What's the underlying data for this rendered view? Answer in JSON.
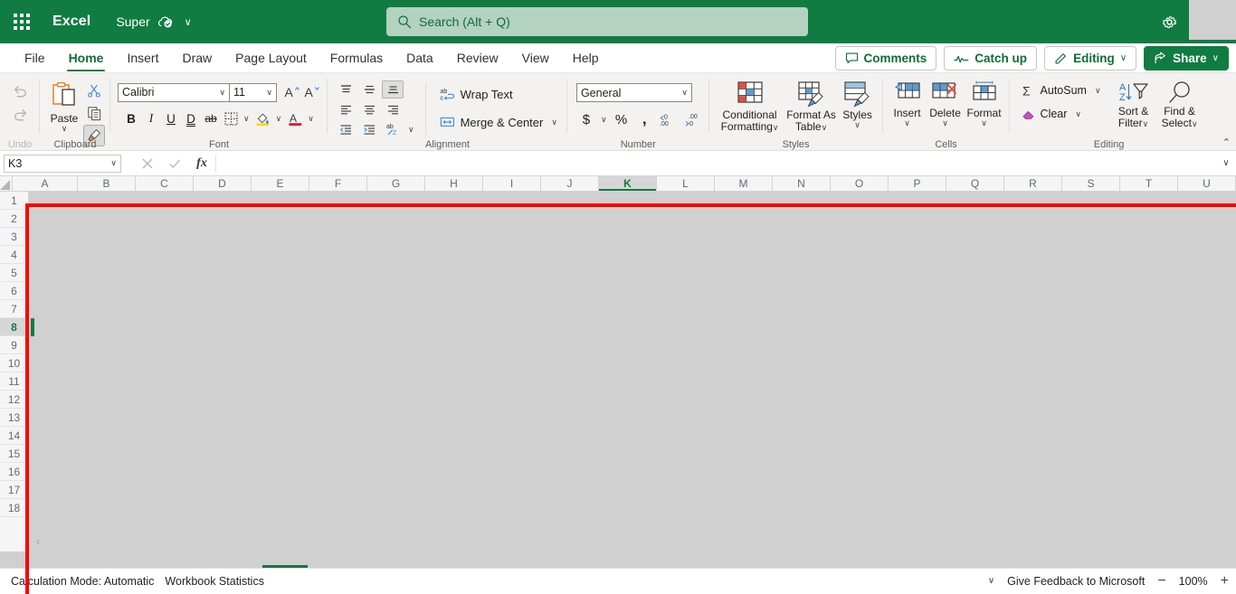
{
  "titlebar": {
    "waffle_label": "app-launcher",
    "app_name": "Excel",
    "document_name": "Super",
    "saved_icon": "cloud-saved-icon",
    "chevron": "∨",
    "settings_icon": "gear-icon"
  },
  "search": {
    "placeholder": "Search (Alt + Q)",
    "value": "",
    "icon": "search-icon"
  },
  "tabs": [
    {
      "label": "File",
      "active": false
    },
    {
      "label": "Home",
      "active": true
    },
    {
      "label": "Insert",
      "active": false
    },
    {
      "label": "Draw",
      "active": false
    },
    {
      "label": "Page Layout",
      "active": false
    },
    {
      "label": "Formulas",
      "active": false
    },
    {
      "label": "Data",
      "active": false
    },
    {
      "label": "Review",
      "active": false
    },
    {
      "label": "View",
      "active": false
    },
    {
      "label": "Help",
      "active": false
    }
  ],
  "tab_actions": {
    "comments": "Comments",
    "catch_up": "Catch up",
    "editing": "Editing",
    "share": "Share",
    "chevron": "∨"
  },
  "ribbon": {
    "undo_group": {
      "label": "Undo",
      "undo": "Undo",
      "redo": "Redo"
    },
    "clipboard": {
      "label": "Clipboard",
      "paste": "Paste",
      "cut": "Cut",
      "copy": "Copy",
      "format_painter": "Format Painter",
      "chevron": "∨"
    },
    "font": {
      "label": "Font",
      "font_name": "Calibri",
      "font_size": "11",
      "grow": "A",
      "shrink": "A",
      "bold": "B",
      "italic": "I",
      "underline": "U",
      "double_underline": "D",
      "strikethrough": "ab",
      "borders": "Borders",
      "fill_color": "Fill Color",
      "font_color": "A",
      "chevron": "∨",
      "fill_swatch": "#ffd900",
      "font_swatch": "#e81123"
    },
    "alignment": {
      "label": "Alignment",
      "top_align": "Top Align",
      "middle_align": "Middle Align",
      "bottom_align": "Bottom Align",
      "align_left": "Align Left",
      "center": "Center",
      "align_right": "Align Right",
      "decrease_indent": "Decrease Indent",
      "increase_indent": "Increase Indent",
      "orientation": "Orientation",
      "wrap_text": "Wrap Text",
      "merge_center": "Merge & Center",
      "chevron": "∨"
    },
    "number": {
      "label": "Number",
      "format": "General",
      "currency": "$",
      "percent": "%",
      "comma": " ,",
      "increase_decimal": "Increase Decimal",
      "decrease_decimal": "Decrease Decimal",
      "chevron": "∨"
    },
    "styles": {
      "label": "Styles",
      "conditional_formatting": "Conditional Formatting",
      "format_as_table": "Format As Table",
      "styles": "Styles",
      "chevron": "∨"
    },
    "cells": {
      "label": "Cells",
      "insert": "Insert",
      "delete": "Delete",
      "format": "Format",
      "chevron": "∨"
    },
    "editing": {
      "label": "Editing",
      "autosum": "AutoSum",
      "clear": "Clear",
      "sort_filter": "Sort & Filter",
      "find_select": "Find & Select",
      "chevron": "∨"
    },
    "collapse_ribbon": "⌃"
  },
  "formula_bar": {
    "name_box": "K3",
    "name_chevron": "∨",
    "cancel": "✕",
    "enter": "✓",
    "function": "fx",
    "formula_value": "",
    "formula_placeholder": "",
    "expand": "∨"
  },
  "grid": {
    "columns": [
      "A",
      "B",
      "C",
      "D",
      "E",
      "F",
      "G",
      "H",
      "I",
      "J",
      "K",
      "L",
      "M",
      "N",
      "O",
      "P",
      "Q",
      "R",
      "S",
      "T",
      "U"
    ],
    "selected_column": "K",
    "rows": [
      "1",
      "2",
      "3",
      "4",
      "5",
      "6",
      "7",
      "8",
      "9",
      "10",
      "11",
      "12",
      "13",
      "14",
      "15",
      "16",
      "17",
      "18"
    ],
    "selected_row": "8",
    "nav_left": "‹"
  },
  "status_bar": {
    "calculation_mode": "Calculation Mode: Automatic",
    "workbook_statistics": "Workbook Statistics",
    "options_chevron": "∨",
    "feedback": "Give Feedback to Microsoft",
    "zoom_out": "−",
    "zoom_level": "100%",
    "zoom_in": "+"
  },
  "annotation": {
    "color": "#fe0000",
    "name": "red-highlight-border"
  }
}
